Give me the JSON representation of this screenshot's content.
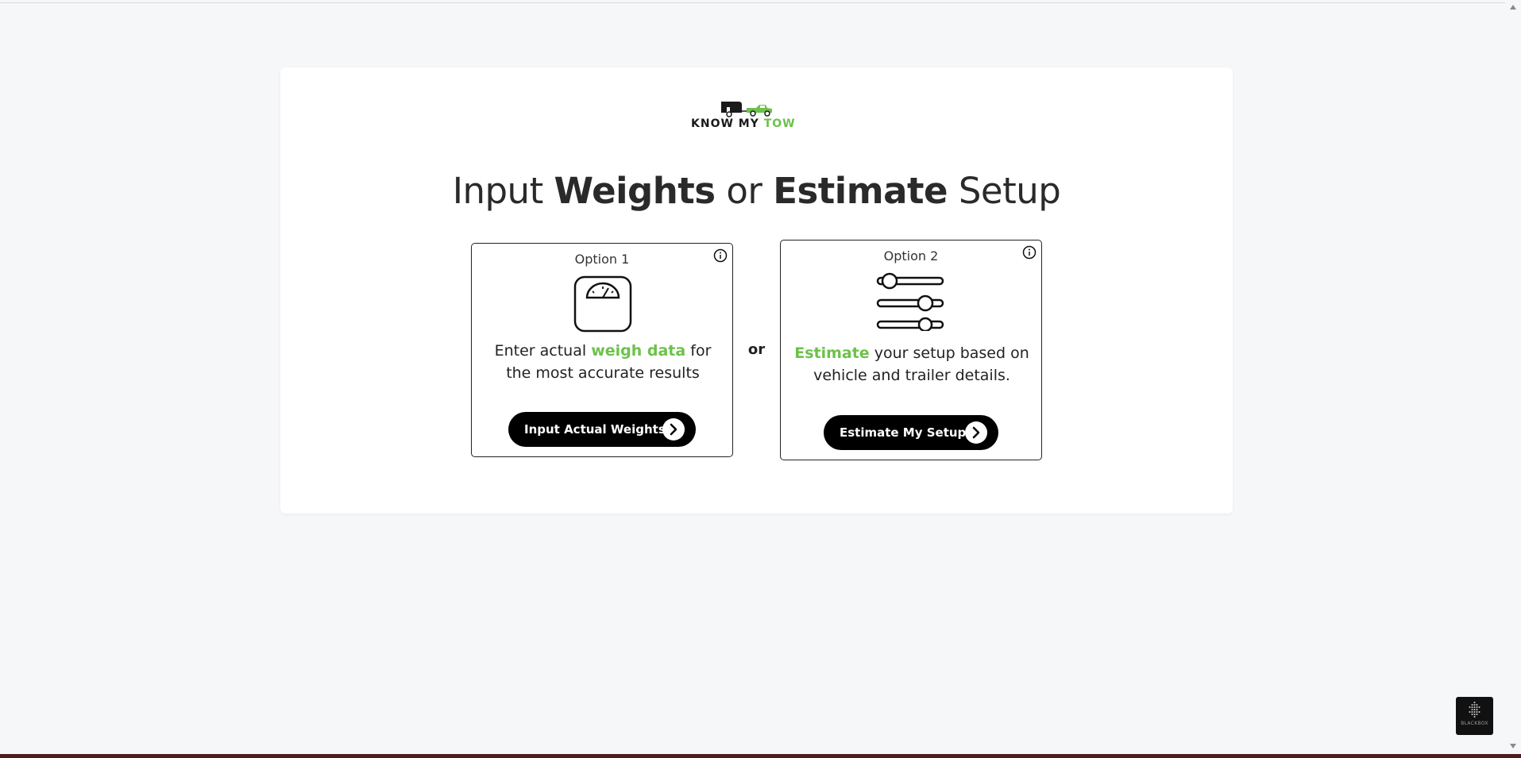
{
  "logo": {
    "text_dark": "KNOW MY",
    "text_green": "TOW",
    "icon": "truck-trailer-icon"
  },
  "heading": {
    "part1": "Input",
    "part2": "Weights",
    "part3": "or",
    "part4": "Estimate",
    "part5": "Setup"
  },
  "option1": {
    "label": "Option 1",
    "icon": "scale-icon",
    "desc_pre": "Enter actual",
    "desc_highlight": "weigh data",
    "desc_post": "for the most accurate results",
    "button_label": "Input Actual Weights"
  },
  "separator": "or",
  "option2": {
    "label": "Option 2",
    "icon": "sliders-icon",
    "desc_highlight": "Estimate",
    "desc_post": "your setup based on vehicle and trailer details.",
    "button_label": "Estimate My Setup"
  },
  "widget": {
    "label": "BLACKBOX"
  },
  "colors": {
    "accent_green": "#6cc24a",
    "button_bg": "#000000",
    "page_bg": "#f6f7f9"
  }
}
